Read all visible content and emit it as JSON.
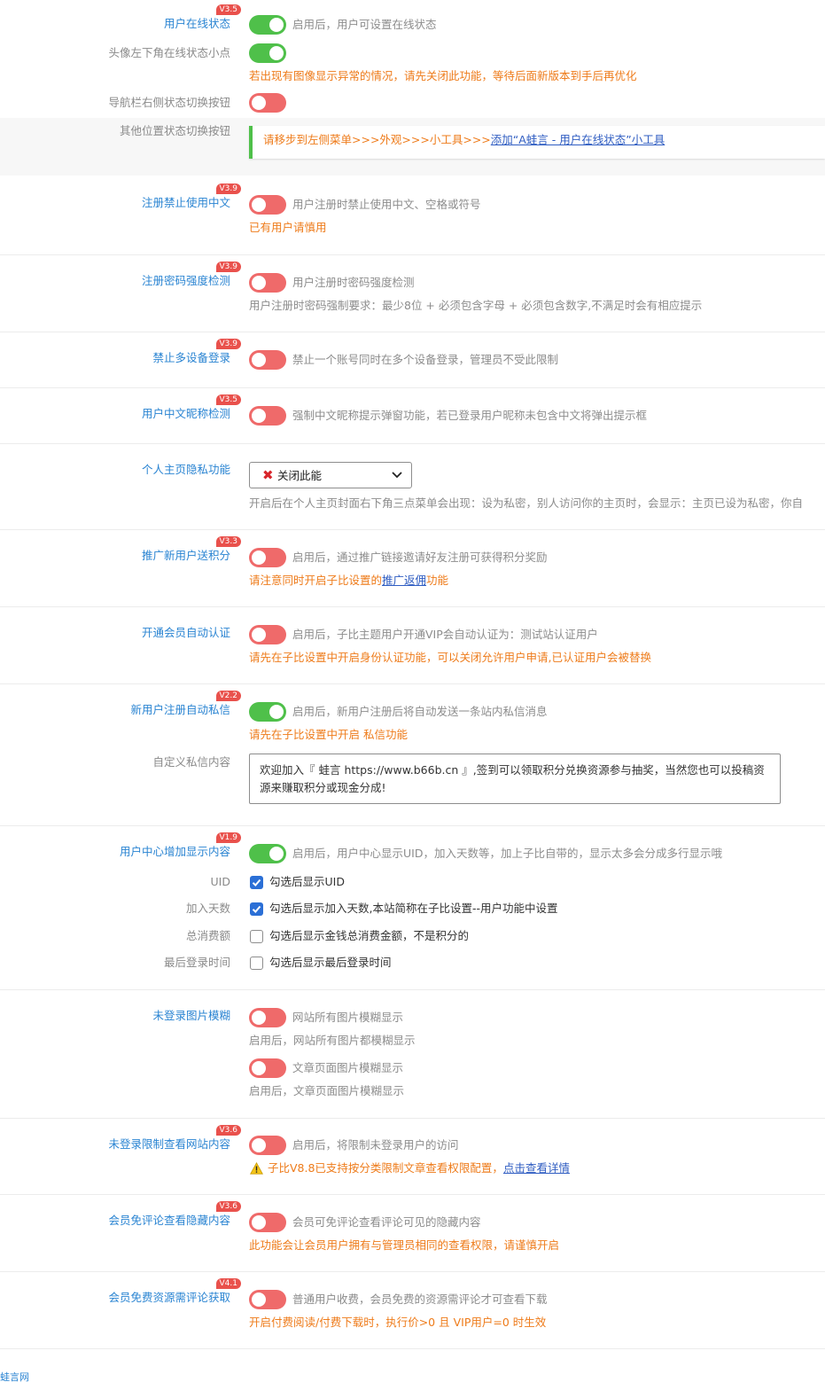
{
  "rows": {
    "online_status": {
      "label": "用户在线状态",
      "version": "V3.5",
      "desc": "启用后，用户可设置在线状态",
      "state": "on"
    },
    "avatar_dot": {
      "label": "头像左下角在线状态小点",
      "state": "on",
      "warn": "若出现有图像显示异常的情况，请先关闭此功能，等待后面新版本到手后再优化"
    },
    "nav_toggle": {
      "label": "导航栏右侧状态切换按钮",
      "state": "off"
    },
    "other_toggle": {
      "label": "其他位置状态切换按钮",
      "notice_prefix": "请移步到左侧菜单>>>外观>>>小工具>>>",
      "notice_link": "添加“A蛙言 - 用户在线状态”小工具"
    },
    "no_chinese": {
      "label": "注册禁止使用中文",
      "version": "V3.9",
      "desc": "用户注册时禁止使用中文、空格或符号",
      "warn": "已有用户请慎用",
      "state": "off"
    },
    "pwd_strength": {
      "label": "注册密码强度检测",
      "version": "V3.9",
      "desc": "用户注册时密码强度检测",
      "desc2": "用户注册时密码强制要求：最少8位 + 必须包含字母 + 必须包含数字,不满足时会有相应提示",
      "state": "off"
    },
    "multi_device": {
      "label": "禁止多设备登录",
      "version": "V3.9",
      "desc": "禁止一个账号同时在多个设备登录，管理员不受此限制",
      "state": "off"
    },
    "nickname_check": {
      "label": "用户中文昵称检测",
      "version": "V3.5",
      "desc": "强制中文昵称提示弹窗功能，若已登录用户昵称未包含中文将弹出提示框",
      "state": "off"
    },
    "privacy": {
      "label": "个人主页隐私功能",
      "select_value": "关闭此能",
      "desc": "开启后在个人主页封面右下角三点菜单会出现：设为私密，别人访问你的主页时，会显示：主页已设为私密，你自"
    },
    "referral": {
      "label": "推广新用户送积分",
      "version": "V3.3",
      "desc": "启用后，通过推广链接邀请好友注册可获得积分奖励",
      "warn_prefix": "请注意同时开启子比设置的",
      "warn_link": "推广返佣",
      "warn_suffix": "功能",
      "state": "off"
    },
    "vip_auth": {
      "label": "开通会员自动认证",
      "desc": "启用后，子比主题用户开通VIP会自动认证为：测试站认证用户",
      "warn": "请先在子比设置中开启身份认证功能，可以关闭允许用户申请,已认证用户会被替换",
      "state": "off"
    },
    "auto_msg": {
      "label": "新用户注册自动私信",
      "version": "V2.2",
      "desc": "启用后，新用户注册后将自动发送一条站内私信消息",
      "warn": "请先在子比设置中开启 私信功能",
      "state": "on",
      "custom_label": "自定义私信内容",
      "custom_text": "欢迎加入『 蛙言 https://www.b66b.cn 』,签到可以领取积分兑换资源参与抽奖，当然您也可以投稿资源来赚取积分或现金分成!"
    },
    "user_center": {
      "label": "用户中心增加显示内容",
      "version": "V1.9",
      "desc": "启用后，用户中心显示UID，加入天数等，加上子比自带的，显示太多会分成多行显示哦",
      "state": "on",
      "options": [
        {
          "label": "UID",
          "text": "勾选后显示UID",
          "checked": true
        },
        {
          "label": "加入天数",
          "text": "勾选后显示加入天数,本站简称在子比设置--用户功能中设置",
          "checked": true
        },
        {
          "label": "总消费额",
          "text": "勾选后显示金钱总消费金额，不是积分的",
          "checked": false
        },
        {
          "label": "最后登录时间",
          "text": "勾选后显示最后登录时间",
          "checked": false
        }
      ]
    },
    "blur": {
      "label": "未登录图片模糊",
      "opt1": "网站所有图片模糊显示",
      "desc1": "启用后，网站所有图片都模糊显示",
      "opt2": "文章页面图片模糊显示",
      "desc2": "启用后，文章页面图片模糊显示",
      "state": "off"
    },
    "restrict": {
      "label": "未登录限制查看网站内容",
      "version": "V3.6",
      "desc": "启用后，将限制未登录用户的访问",
      "warn": "子比V8.8已支持按分类限制文章查看权限配置，",
      "warn_link": "点击查看详情",
      "state": "off"
    },
    "vip_hidden": {
      "label": "会员免评论查看隐藏内容",
      "version": "V3.6",
      "desc": "会员可免评论查看评论可见的隐藏内容",
      "warn": "此功能会让会员用户拥有与管理员相同的查看权限，请谨慎开启",
      "state": "off"
    },
    "vip_res": {
      "label": "会员免费资源需评论获取",
      "version": "V4.1",
      "desc": "普通用户收费，会员免费的资源需评论才可查看下载",
      "warn": "开启付费阅读/付费下载时，执行价>0 且 VIP用户=0 时生效",
      "state": "off"
    }
  },
  "footer": "蛙言网",
  "colors": {
    "accent": "#2a84d2",
    "on": "#4fc04a",
    "off": "#ef6a6a",
    "warn": "#ee7b1a",
    "badge": "#e9514c"
  }
}
